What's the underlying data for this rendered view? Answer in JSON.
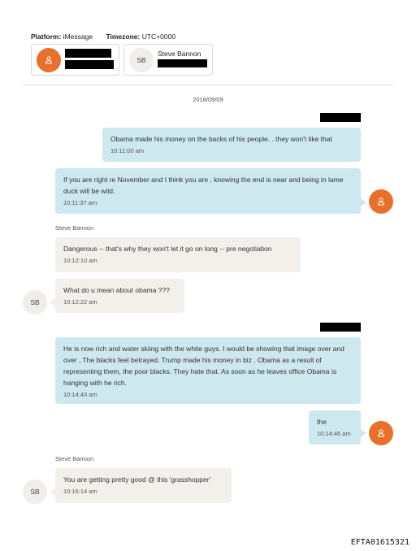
{
  "header": {
    "platform_label": "Platform:",
    "platform_value": "iMessage",
    "timezone_label": "Timezone:",
    "timezone_value": "UTC+0000"
  },
  "participants": [
    {
      "initials": "",
      "name": "",
      "redacted": true,
      "avatar_icon": "person-icon"
    },
    {
      "initials": "SB",
      "name": "Steve Bannon",
      "redacted_number": true
    }
  ],
  "date_divider": "2018/09/09",
  "messages": [
    {
      "direction": "outgoing",
      "text": "Obama made his money on the backs of his people. .  they won't like that",
      "time": "10:11:00 am"
    },
    {
      "direction": "outgoing",
      "text": "If you are right re November and I think you are ,  knowing the end is near and being in lame duck will be wild.",
      "time": "10:11:37 am"
    },
    {
      "direction": "incoming",
      "sender": "Steve Bannon",
      "text": "Dangerous -- that's why they won't let it go on long -- pre negotiation",
      "time": "10:12:10 am"
    },
    {
      "direction": "incoming",
      "text": "What do u mean about obama ???",
      "time": "10:12:22 am",
      "avatar": "SB"
    },
    {
      "direction": "outgoing",
      "text": "He is now rich and water skiing with the white guys.  I would be showing that image over and over , The blacks feel betrayed.  Trump made his money in biz .  Obama as a result of representing them, the  poor blacks.  They hate that.  As soon as he leaves office Obama is hanging with he rich.",
      "time": "10:14:43 am"
    },
    {
      "direction": "outgoing",
      "text": "the",
      "time": "10:14:46 am"
    },
    {
      "direction": "incoming",
      "sender": "Steve Bannon",
      "text": "You are getting pretty good @ this 'grasshopper'",
      "time": "10:16:14 am",
      "avatar": "SB"
    }
  ],
  "footer_id": "EFTA01615321",
  "colors": {
    "outgoing_bubble": "#cde8ef",
    "incoming_bubble": "#f3f0ec",
    "avatar_orange": "#e8702a"
  }
}
